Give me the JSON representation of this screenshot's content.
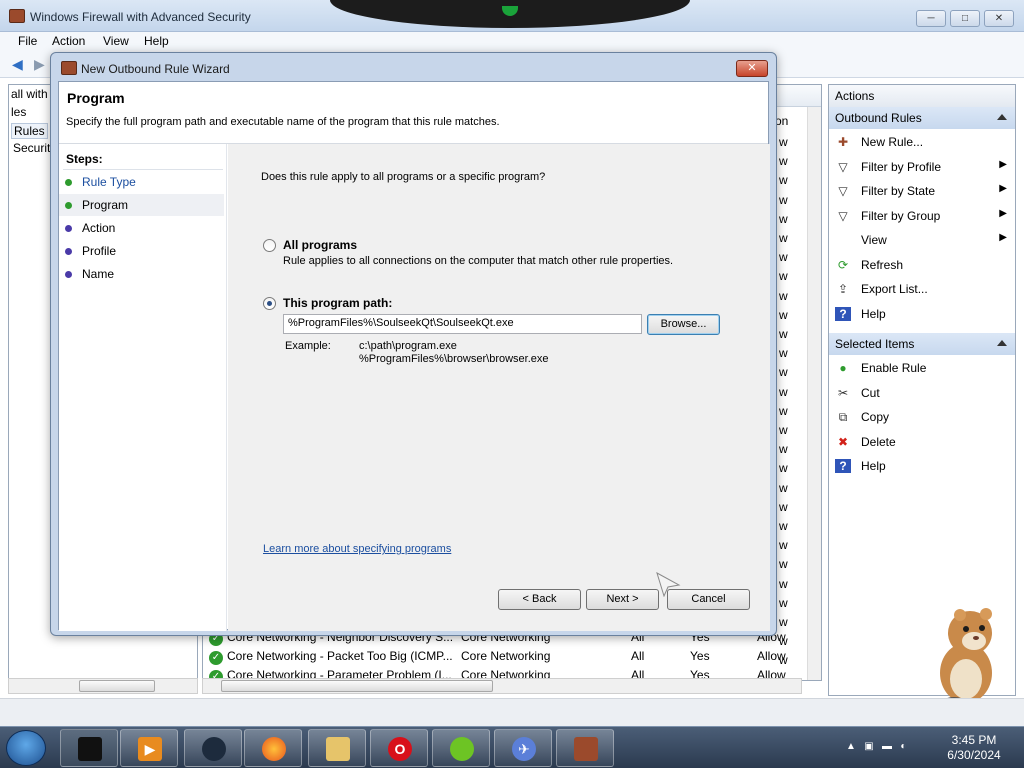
{
  "window": {
    "title": "Windows Firewall with Advanced Security",
    "btn_min": "─",
    "btn_max": "□",
    "btn_close": "✕"
  },
  "menu": [
    "File",
    "Action",
    "View",
    "Help"
  ],
  "tree": [
    "all with",
    "les",
    "Rules",
    "Securit"
  ],
  "list": {
    "header_col": "on",
    "rows": [
      {
        "name": "Core Networking - Neighbor Discovery S...",
        "group": "Core Networking",
        "profile": "All",
        "enabled": "Yes",
        "action": "Allow"
      },
      {
        "name": "Core Networking - Packet Too Big (ICMP...",
        "group": "Core Networking",
        "profile": "All",
        "enabled": "Yes",
        "action": "Allow"
      },
      {
        "name": "Core Networking - Parameter Problem (I...",
        "group": "Core Networking",
        "profile": "All",
        "enabled": "Yes",
        "action": "Allow"
      }
    ],
    "hidden_col_value": "w"
  },
  "actions": {
    "title": "Actions",
    "section1": "Outbound Rules",
    "items1": [
      {
        "label": "New Rule...",
        "icon": "new-rule-icon"
      },
      {
        "label": "Filter by Profile",
        "icon": "filter-icon",
        "sub": true
      },
      {
        "label": "Filter by State",
        "icon": "filter-icon",
        "sub": true
      },
      {
        "label": "Filter by Group",
        "icon": "filter-icon",
        "sub": true
      },
      {
        "label": "View",
        "icon": "",
        "sub": true
      },
      {
        "label": "Refresh",
        "icon": "refresh-icon"
      },
      {
        "label": "Export List...",
        "icon": "export-icon"
      },
      {
        "label": "Help",
        "icon": "help-icon"
      }
    ],
    "section2": "Selected Items",
    "items2": [
      {
        "label": "Enable Rule",
        "icon": "enable-icon"
      },
      {
        "label": "Cut",
        "icon": "cut-icon"
      },
      {
        "label": "Copy",
        "icon": "copy-icon"
      },
      {
        "label": "Delete",
        "icon": "delete-icon"
      },
      {
        "label": "Help",
        "icon": "help-icon"
      }
    ]
  },
  "dialog": {
    "title": "New Outbound Rule Wizard",
    "close": "✕",
    "heading": "Program",
    "description": "Specify the full program path and executable name of the program that this rule matches.",
    "steps_label": "Steps:",
    "steps": [
      {
        "label": "Rule Type",
        "state": "done"
      },
      {
        "label": "Program",
        "state": "current"
      },
      {
        "label": "Action",
        "state": "pending"
      },
      {
        "label": "Profile",
        "state": "pending"
      },
      {
        "label": "Name",
        "state": "pending"
      }
    ],
    "question": "Does this rule apply to all programs or a specific program?",
    "all_programs": "All programs",
    "all_programs_desc": "Rule applies to all connections on the computer that match other rule properties.",
    "this_program": "This program path:",
    "path_value": "%ProgramFiles%\\SoulseekQt\\SoulseekQt.exe",
    "browse": "Browse...",
    "example_label": "Example:",
    "example_1": "c:\\path\\program.exe",
    "example_2": "%ProgramFiles%\\browser\\browser.exe",
    "learn_more": "Learn more about specifying programs",
    "back": "< Back",
    "next": "Next >",
    "cancel": "Cancel",
    "selected_option": "this_program"
  },
  "taskbar": {
    "time": "3:45 PM",
    "date": "6/30/2024"
  },
  "colors": {
    "step_done": "#2e9b2e",
    "step_current": "#2e9b2e",
    "step_pending": "#4a3aa8",
    "link": "#1c4fa0"
  }
}
